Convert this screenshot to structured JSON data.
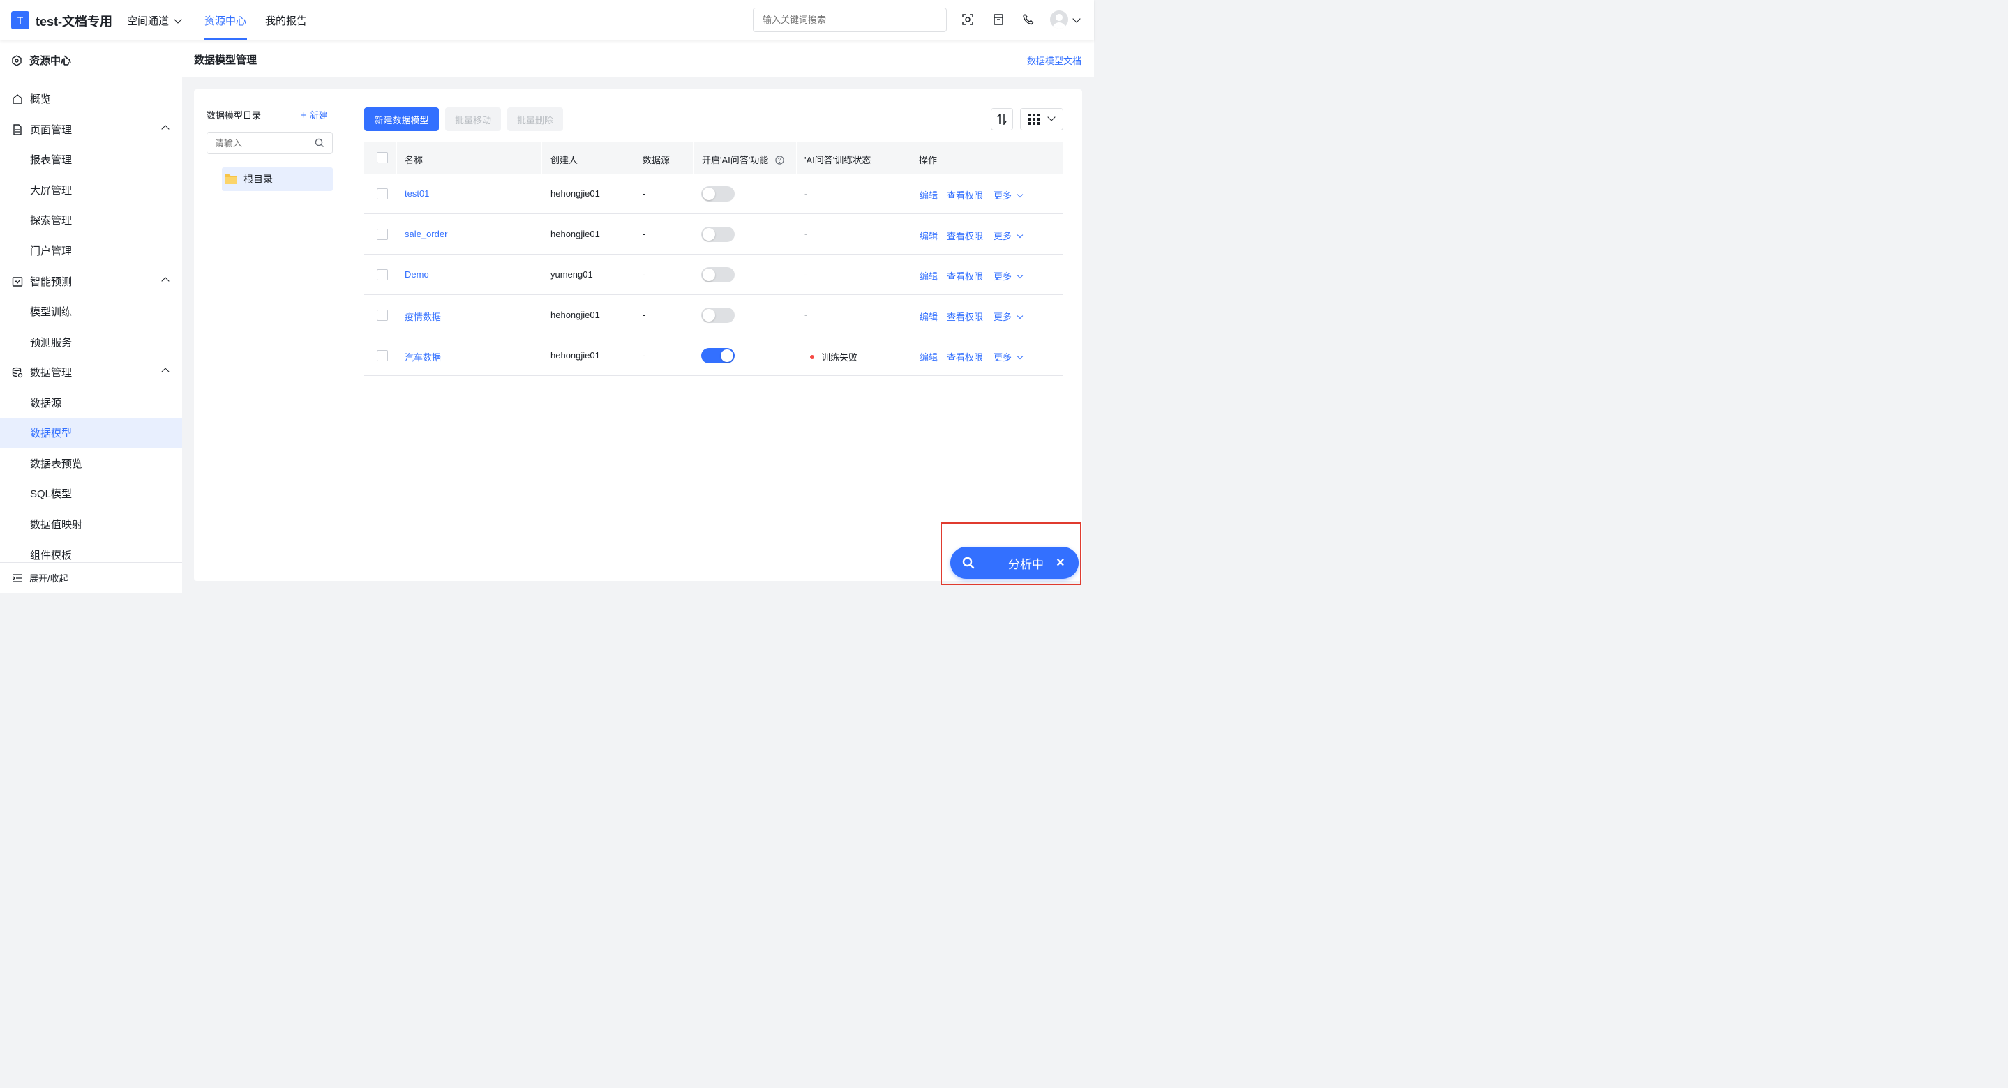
{
  "app": {
    "logo_letter": "T",
    "title": "test-文档专用"
  },
  "nav": {
    "space_channel": "空间通道",
    "resource_center": "资源中心",
    "my_reports": "我的报告"
  },
  "search": {
    "placeholder": "输入关键词搜索"
  },
  "sidebar": {
    "header": "资源中心",
    "overview": "概览",
    "page_mgmt": "页面管理",
    "report_mgmt": "报表管理",
    "bigscreen_mgmt": "大屏管理",
    "explore_mgmt": "探索管理",
    "portal_mgmt": "门户管理",
    "smart_predict": "智能预测",
    "model_training": "模型训练",
    "predict_service": "预测服务",
    "data_mgmt": "数据管理",
    "datasource": "数据源",
    "data_model": "数据模型",
    "table_preview": "数据表预览",
    "sql_model": "SQL模型",
    "value_mapping": "数据值映射",
    "component_template": "组件模板",
    "footer": "展开/收起"
  },
  "page": {
    "title": "数据模型管理",
    "doc_link": "数据模型文档"
  },
  "tree": {
    "title": "数据模型目录",
    "new_label": "新建",
    "input_placeholder": "请输入",
    "root": "根目录"
  },
  "toolbar": {
    "new_model": "新建数据模型",
    "batch_move": "批量移动",
    "batch_delete": "批量删除"
  },
  "table": {
    "headers": {
      "name": "名称",
      "creator": "创建人",
      "datasource": "数据源",
      "ai_enable": "开启'AI问答'功能",
      "ai_status": "'AI问答'训练状态",
      "actions": "操作"
    },
    "rows": [
      {
        "name": "test01",
        "creator": "hehongjie01",
        "datasource": "-",
        "ai_on": false,
        "status": "-"
      },
      {
        "name": "sale_order",
        "creator": "hehongjie01",
        "datasource": "-",
        "ai_on": false,
        "status": "-"
      },
      {
        "name": "Demo",
        "creator": "yumeng01",
        "datasource": "-",
        "ai_on": false,
        "status": "-"
      },
      {
        "name": "疫情数据",
        "creator": "hehongjie01",
        "datasource": "-",
        "ai_on": false,
        "status": "-"
      },
      {
        "name": "汽车数据",
        "creator": "hehongjie01",
        "datasource": "-",
        "ai_on": true,
        "status": "训练失败"
      }
    ],
    "actions": {
      "edit": "编辑",
      "view_perm": "查看权限",
      "more": "更多"
    }
  },
  "floating": {
    "label": "分析中"
  },
  "colors": {
    "accent": "#3370ff",
    "error": "#f54a45",
    "highlight_frame": "#e03b2f"
  }
}
